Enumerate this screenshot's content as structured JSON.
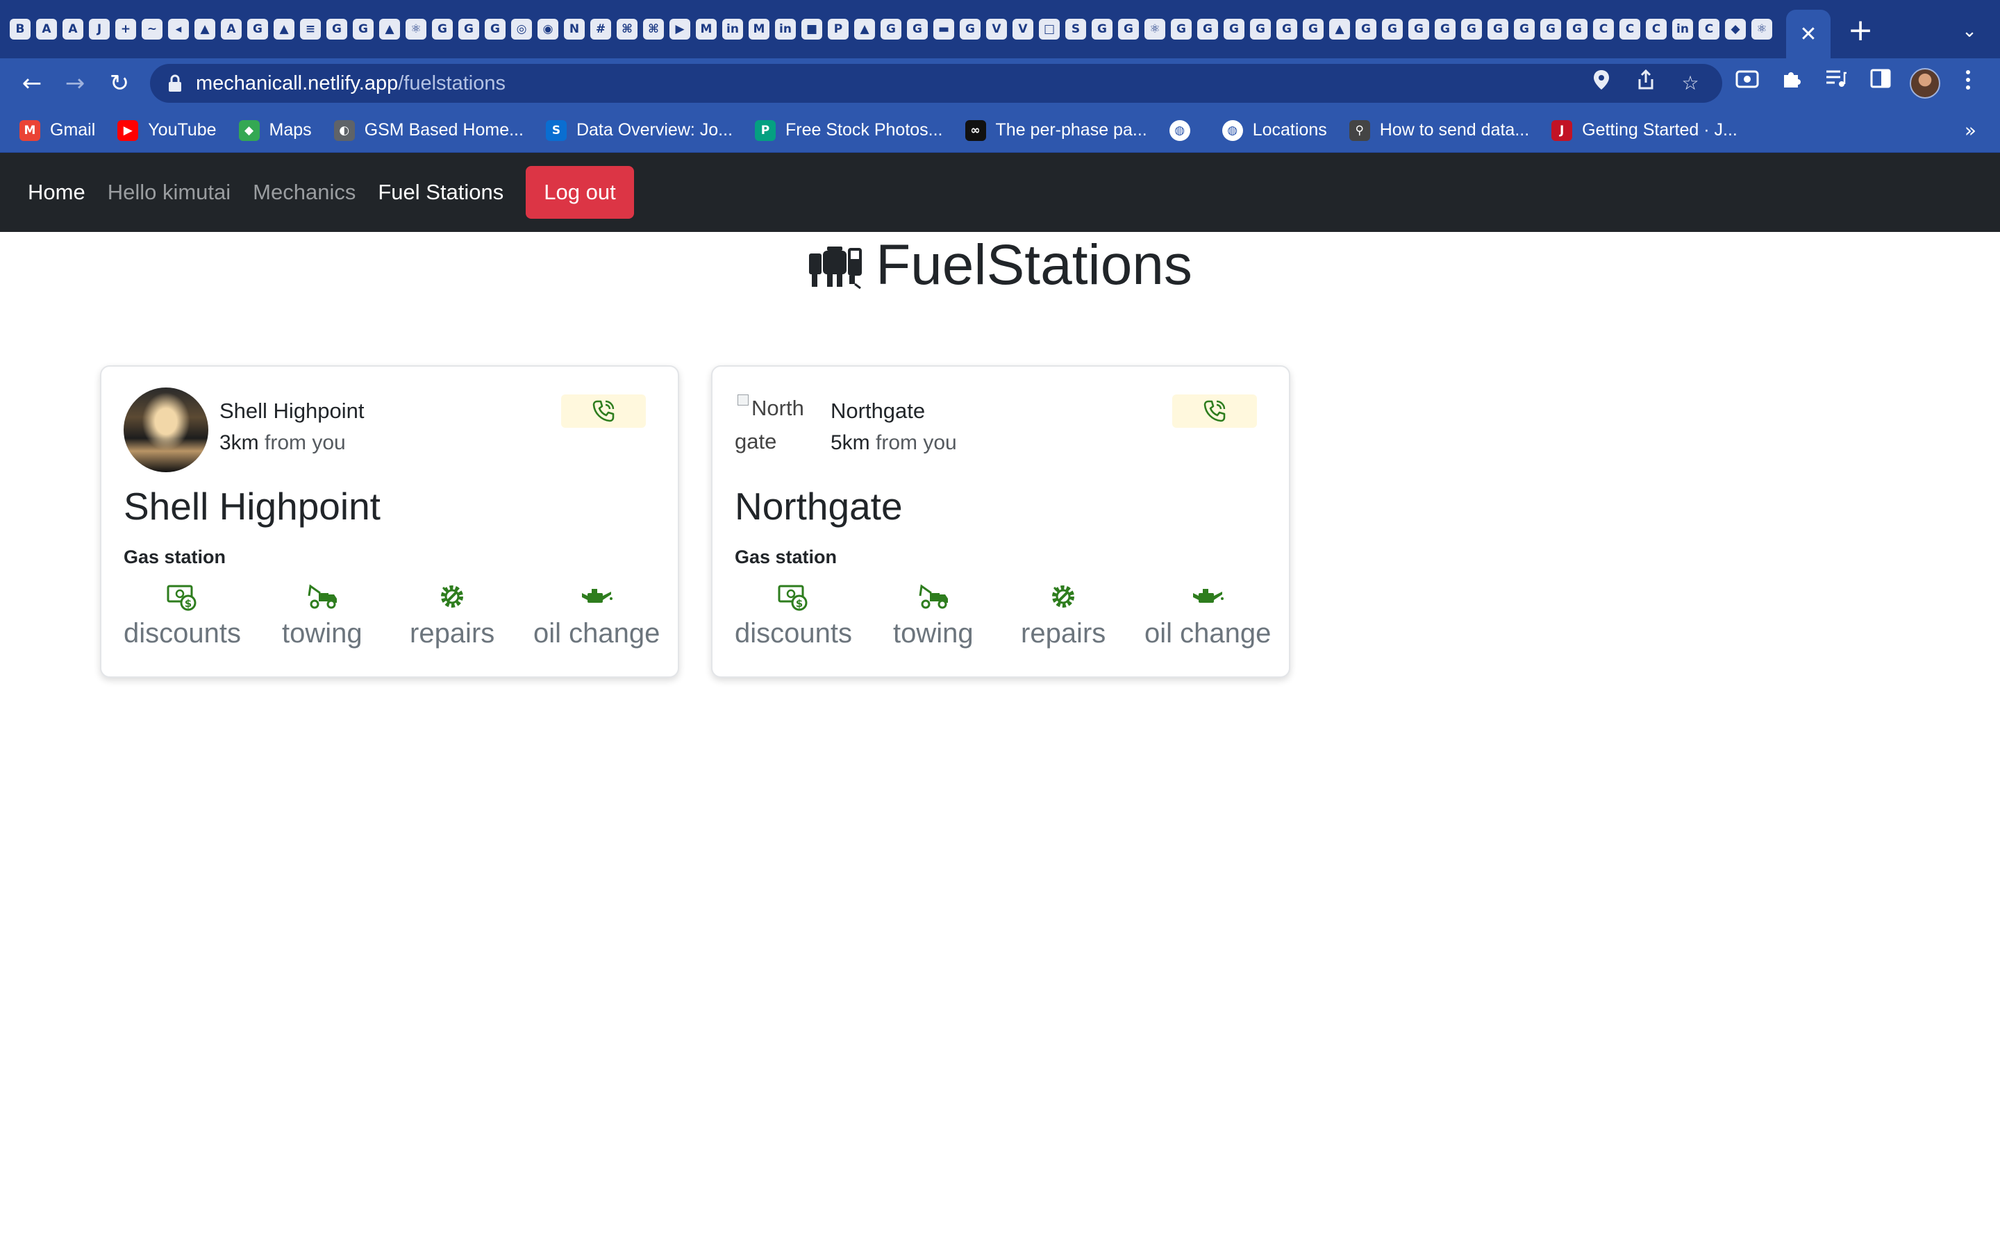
{
  "browser": {
    "tab_favicons": [
      "B",
      "A",
      "A",
      "J",
      "+",
      "~",
      "◂",
      "▲",
      "A",
      "G",
      "▲",
      "≡",
      "G",
      "G",
      "▲",
      "⚛",
      "G",
      "G",
      "G",
      "◎",
      "◉",
      "N",
      "#",
      "⌘",
      "⌘",
      "▶",
      "M",
      "in",
      "M",
      "in",
      "■",
      "P",
      "▲",
      "G",
      "G",
      "▬",
      "G",
      "V",
      "V",
      "□",
      "S",
      "G",
      "G",
      "⚛",
      "G",
      "G",
      "G",
      "G",
      "G",
      "G",
      "▲",
      "G",
      "G",
      "G",
      "G",
      "G",
      "G",
      "G",
      "G",
      "G",
      "C",
      "C",
      "C",
      "in",
      "C",
      "◆",
      "⚛"
    ],
    "active_tab_close": "✕",
    "new_tab": "+",
    "tab_menu": "⌄",
    "back_icon": "←",
    "forward_icon": "→",
    "reload_icon": "↻",
    "url": {
      "host": "mechanicall.netlify.app",
      "path": "/fuelstations"
    },
    "lock_icon": "🔒",
    "location_icon": "⚲",
    "share_icon": "⇪",
    "star_icon": "☆",
    "toolbar_icons": [
      "◘",
      "✚",
      "≡",
      "▥",
      "⋮"
    ],
    "bookmarks": [
      {
        "label": "Gmail",
        "icon": "M",
        "color": "#ea4335"
      },
      {
        "label": "YouTube",
        "icon": "▶",
        "color": "#ff0000"
      },
      {
        "label": "Maps",
        "icon": "◆",
        "color": "#34a853"
      },
      {
        "label": "GSM Based Home...",
        "icon": "◐",
        "color": "#5f6368"
      },
      {
        "label": "Data Overview: Jo...",
        "icon": "S",
        "color": "#0a6ed1"
      },
      {
        "label": "Free Stock Photos...",
        "icon": "P",
        "color": "#05a081"
      },
      {
        "label": "The per-phase pa...",
        "icon": "∞",
        "color": "#111111"
      },
      {
        "label": "",
        "icon": "◍",
        "color": "#ffffff"
      },
      {
        "label": "Locations",
        "icon": "◍",
        "color": "#ffffff"
      },
      {
        "label": "How to send data...",
        "icon": "⚲",
        "color": "#444444"
      },
      {
        "label": "Getting Started · J...",
        "icon": "J",
        "color": "#c21325"
      }
    ],
    "bookmarks_more": "»"
  },
  "app": {
    "nav": {
      "home": "Home",
      "greeting": "Hello kimutai",
      "mechanics": "Mechanics",
      "fuel_stations": "Fuel Stations",
      "logout": "Log out"
    },
    "page_title": "FuelStations",
    "title_icon": "fuel-truck-icon",
    "accent_color": "#2e7d1e",
    "stations": [
      {
        "name": "Shell Highpoint",
        "distance_value": "3km",
        "distance_suffix": " from you",
        "title": "Shell Highpoint",
        "type": "Gas station",
        "image": "photo",
        "image_alt": ""
      },
      {
        "name": "Northgate",
        "distance_value": "5km",
        "distance_suffix": " from you",
        "title": "Northgate",
        "type": "Gas station",
        "image": "broken",
        "image_alt": "Northgate"
      }
    ],
    "features": [
      {
        "label": "discounts",
        "icon": "cash-icon"
      },
      {
        "label": "towing",
        "icon": "tow-truck-icon"
      },
      {
        "label": "repairs",
        "icon": "gear-wrench-icon"
      },
      {
        "label": "oil change",
        "icon": "oil-can-icon"
      }
    ]
  }
}
